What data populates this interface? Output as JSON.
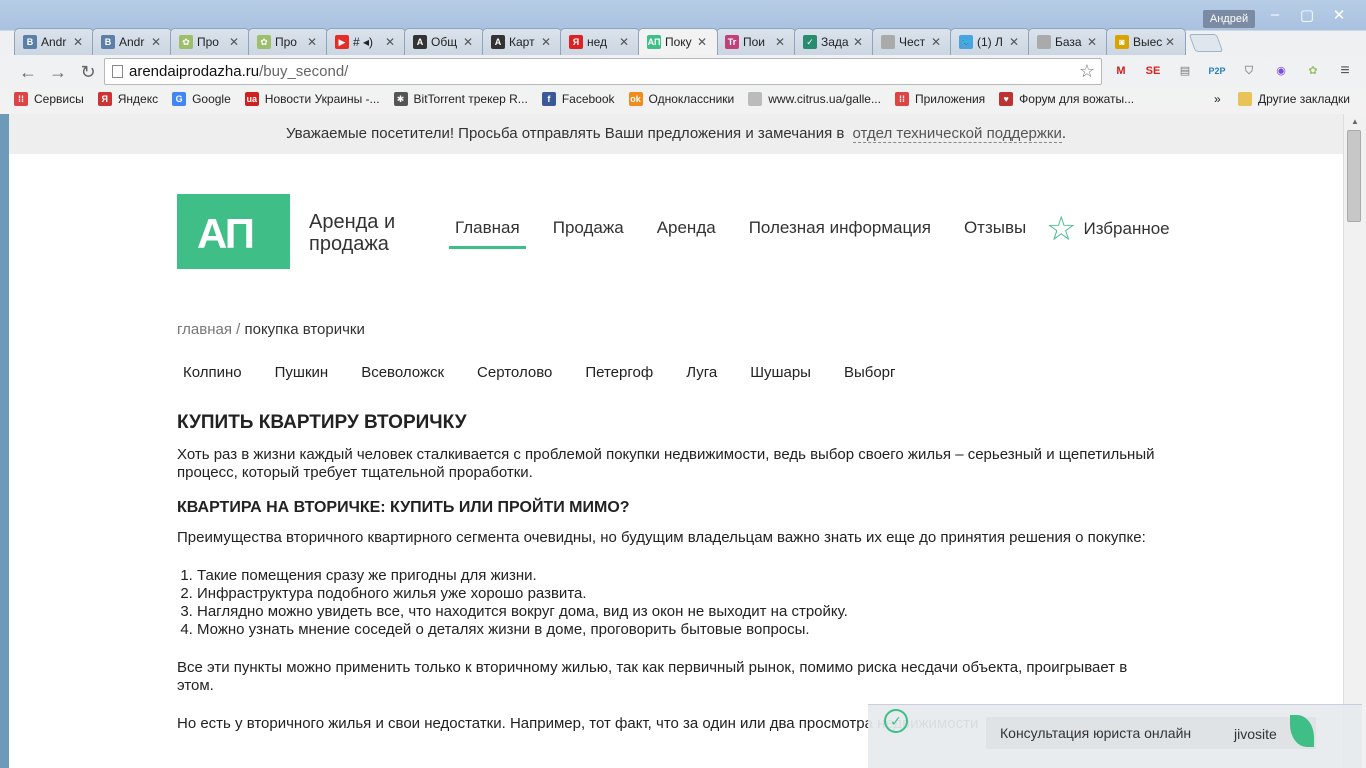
{
  "browser": {
    "user": "Андрей",
    "tabs": [
      {
        "title": "Andr",
        "icon_color": "#5b7fa6",
        "icon_text": "B"
      },
      {
        "title": "Andr",
        "icon_color": "#5b7fa6",
        "icon_text": "B"
      },
      {
        "title": "Про",
        "icon_color": "#9bbf6a",
        "icon_text": "✿"
      },
      {
        "title": "Про",
        "icon_color": "#9bbf6a",
        "icon_text": "✿"
      },
      {
        "title": "# ◂)",
        "icon_color": "#e52d27",
        "icon_text": "▶"
      },
      {
        "title": "Общ",
        "icon_color": "#333333",
        "icon_text": "A"
      },
      {
        "title": "Карт",
        "icon_color": "#333333",
        "icon_text": "A"
      },
      {
        "title": "нед",
        "icon_color": "#d22",
        "icon_text": "Я"
      },
      {
        "title": "Поку",
        "icon_color": "#3fbf87",
        "icon_text": "АП",
        "active": true
      },
      {
        "title": "Пои",
        "icon_color": "#c2407a",
        "icon_text": "Tr"
      },
      {
        "title": "Зада",
        "icon_color": "#2a8c6e",
        "icon_text": "✓"
      },
      {
        "title": "Чест",
        "icon_color": "#aaaaaa",
        "icon_text": ""
      },
      {
        "title": "(1) Л",
        "icon_color": "#4aa3e0",
        "icon_text": "🐦"
      },
      {
        "title": "База",
        "icon_color": "#aaaaaa",
        "icon_text": ""
      },
      {
        "title": "Выес",
        "icon_color": "#d9a400",
        "icon_text": "◙"
      }
    ],
    "url_host": "arendaiprodazha.ru",
    "url_path": "/buy_second/",
    "bookmarks": [
      {
        "label": "Сервисы",
        "icon_color": "#d44",
        "icon_text": "⁞⁞"
      },
      {
        "label": "Яндекс",
        "icon_color": "#c33",
        "icon_text": "Я"
      },
      {
        "label": "Google",
        "icon_color": "#4285f4",
        "icon_text": "G"
      },
      {
        "label": "Новости Украины -...",
        "icon_color": "#c22",
        "icon_text": "ua"
      },
      {
        "label": "BitTorrent трекер R...",
        "icon_color": "#555",
        "icon_text": "✱"
      },
      {
        "label": "Facebook",
        "icon_color": "#3b5998",
        "icon_text": "f"
      },
      {
        "label": "Одноклассники",
        "icon_color": "#f28a1c",
        "icon_text": "ok"
      },
      {
        "label": "www.citrus.ua/galle...",
        "icon_color": "#bbb",
        "icon_text": ""
      },
      {
        "label": "Приложения",
        "icon_color": "#d44",
        "icon_text": "⁞⁞"
      },
      {
        "label": "Форум для вожаты...",
        "icon_color": "#b33",
        "icon_text": "♥"
      }
    ],
    "bookmarks_more": "»",
    "other_bookmarks": "Другие закладки"
  },
  "page": {
    "notice_text": "Уважаемые посетители! Просьба отправлять Ваши предложения и замечания в",
    "notice_link": "отдел технической поддержки",
    "logo_mark": "АП",
    "logo_text_line1": "Аренда и",
    "logo_text_line2": "продажа",
    "menu": [
      {
        "label": "Главная",
        "active": true
      },
      {
        "label": "Продажа"
      },
      {
        "label": "Аренда"
      },
      {
        "label": "Полезная информация"
      },
      {
        "label": "Отзывы"
      }
    ],
    "favorites_label": "Избранное",
    "breadcrumb_home": "главная",
    "breadcrumb_sep": " / ",
    "breadcrumb_current": "покупка вторички",
    "cities": [
      "Колпино",
      "Пушкин",
      "Всеволожск",
      "Сертолово",
      "Петергоф",
      "Луга",
      "Шушары",
      "Выборг"
    ],
    "h1": "КУПИТЬ КВАРТИРУ ВТОРИЧКУ",
    "p1": "Хоть раз в жизни каждый человек сталкивается с проблемой покупки недвижимости, ведь выбор своего жилья – серьезный и щепетильный процесс, который требует тщательной проработки.",
    "h2": "КВАРТИРА НА ВТОРИЧКЕ: КУПИТЬ ИЛИ ПРОЙТИ МИМО?",
    "p2": "Преимущества вторичного квартирного сегмента очевидны, но будущим владельцам важно знать их еще до принятия решения о покупке:",
    "list": [
      "Такие помещения сразу же пригодны для жизни.",
      "Инфраструктура подобного жилья уже хорошо развита.",
      "Наглядно можно увидеть все, что находится вокруг дома, вид из окон не выходит на стройку.",
      "Можно узнать мнение соседей о деталях жизни в доме, проговорить бытовые вопросы."
    ],
    "p3": "Все эти пункты можно применить только к вторичному жилью, так как первичный рынок, помимо риска несдачи объекта, проигрывает в этом.",
    "p4": "Но есть у вторичного жилья и свои недостатки. Например, тот факт, что за один или два просмотра недвижимости"
  },
  "chat_widget": {
    "label": "Консультация юриста онлайн",
    "brand": "jivosite"
  },
  "colors": {
    "accent": "#3fbf87"
  }
}
